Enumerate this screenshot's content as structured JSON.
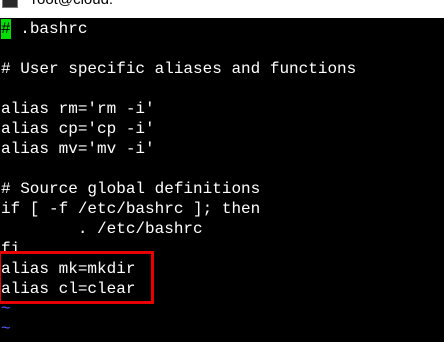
{
  "window": {
    "title": "root@cloud:~",
    "app_icon": "terminal-icon"
  },
  "editor": {
    "cursor_char": "#",
    "line1_rest": " .bashrc",
    "lines": [
      "# User specific aliases and functions",
      "",
      "alias rm='rm -i'",
      "alias cp='cp -i'",
      "alias mv='mv -i'",
      "",
      "# Source global definitions",
      "if [ -f /etc/bashrc ]; then",
      "        . /etc/bashrc",
      "fi",
      "alias mk=mkdir",
      "alias cl=clear"
    ],
    "empty_line_marker": "~"
  },
  "annotation": {
    "highlight_color": "#e80000"
  },
  "colors": {
    "background": "#000000",
    "text": "#ffffff",
    "cursor": "#00dd00",
    "tilde": "#5858ff"
  }
}
